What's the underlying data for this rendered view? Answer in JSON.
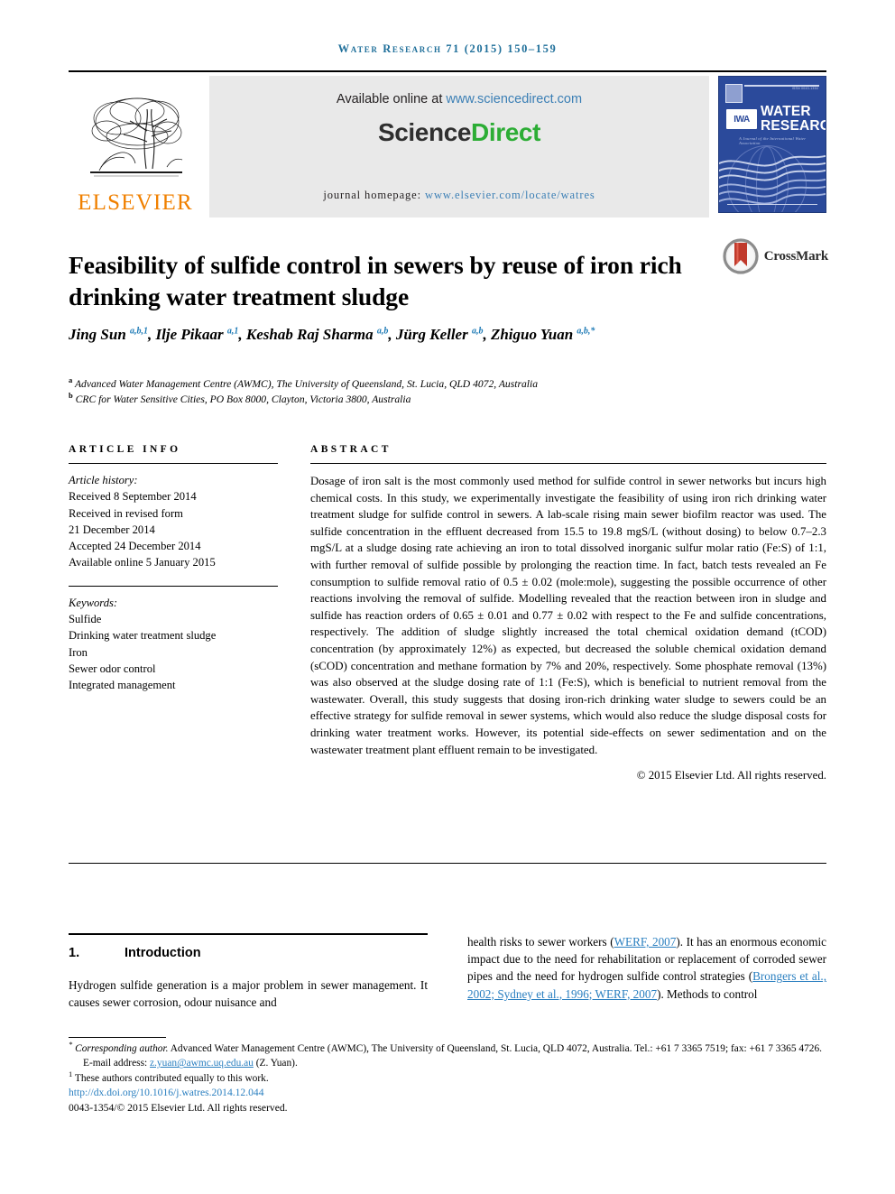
{
  "running_head": "Water Research 71 (2015) 150–159",
  "masthead": {
    "publisher_name": "ELSEVIER",
    "available_prefix": "Available online at ",
    "available_url": "www.sciencedirect.com",
    "wordmark_part1": "Science",
    "wordmark_part2": "Direct",
    "homepage_prefix": "journal homepage: ",
    "homepage_url": "www.elsevier.com/locate/watres",
    "cover": {
      "issn_text": "ISSN 0043-1354",
      "society_mark": "IWA",
      "title_line1": "WATER",
      "title_line2": "RESEARCH",
      "subtitle": "A Journal of the International Water Association"
    }
  },
  "article": {
    "title": "Feasibility of sulfide control in sewers by reuse of iron rich drinking water treatment sludge",
    "crossmark_label": "CrossMark",
    "authors_line1_prefix": "Jing Sun ",
    "authors": [
      {
        "name": "Jing Sun",
        "sup": "a,b,1"
      },
      {
        "name": "Ilje Pikaar",
        "sup": "a,1"
      },
      {
        "name": "Keshab Raj Sharma",
        "sup": "a,b"
      },
      {
        "name": "Jürg Keller",
        "sup": "a,b"
      },
      {
        "name": "Zhiguo Yuan",
        "sup": "a,b,*"
      }
    ],
    "affiliations": [
      {
        "marker": "a",
        "text": "Advanced Water Management Centre (AWMC), The University of Queensland, St. Lucia, QLD 4072, Australia"
      },
      {
        "marker": "b",
        "text": "CRC for Water Sensitive Cities, PO Box 8000, Clayton, Victoria 3800, Australia"
      }
    ]
  },
  "article_info": {
    "heading": "ARTICLE INFO",
    "history_label": "Article history:",
    "history": [
      "Received 8 September 2014",
      "Received in revised form",
      "21 December 2014",
      "Accepted 24 December 2014",
      "Available online 5 January 2015"
    ],
    "keywords_label": "Keywords:",
    "keywords": [
      "Sulfide",
      "Drinking water treatment sludge",
      "Iron",
      "Sewer odor control",
      "Integrated management"
    ]
  },
  "abstract": {
    "heading": "ABSTRACT",
    "text": "Dosage of iron salt is the most commonly used method for sulfide control in sewer networks but incurs high chemical costs. In this study, we experimentally investigate the feasibility of using iron rich drinking water treatment sludge for sulfide control in sewers. A lab-scale rising main sewer biofilm reactor was used. The sulfide concentration in the effluent decreased from 15.5 to 19.8 mgS/L (without dosing) to below 0.7–2.3 mgS/L at a sludge dosing rate achieving an iron to total dissolved inorganic sulfur molar ratio (Fe:S) of 1:1, with further removal of sulfide possible by prolonging the reaction time. In fact, batch tests revealed an Fe consumption to sulfide removal ratio of 0.5 ± 0.02 (mole:mole), suggesting the possible occurrence of other reactions involving the removal of sulfide. Modelling revealed that the reaction between iron in sludge and sulfide has reaction orders of 0.65 ± 0.01 and 0.77 ± 0.02 with respect to the Fe and sulfide concentrations, respectively. The addition of sludge slightly increased the total chemical oxidation demand (tCOD) concentration (by approximately 12%) as expected, but decreased the soluble chemical oxidation demand (sCOD) concentration and methane formation by 7% and 20%, respectively. Some phosphate removal (13%) was also observed at the sludge dosing rate of 1:1 (Fe:S), which is beneficial to nutrient removal from the wastewater. Overall, this study suggests that dosing iron-rich drinking water sludge to sewers could be an effective strategy for sulfide removal in sewer systems, which would also reduce the sludge disposal costs for drinking water treatment works. However, its potential side-effects on sewer sedimentation and on the wastewater treatment plant effluent remain to be investigated.",
    "copyright": "© 2015 Elsevier Ltd. All rights reserved."
  },
  "introduction": {
    "number": "1.",
    "heading": "Introduction",
    "left_text": "Hydrogen sulfide generation is a major problem in sewer management. It causes sewer corrosion, odour nuisance and",
    "right_text_1": "health risks to sewer workers (",
    "right_ref_1": "WERF, 2007",
    "right_text_2": "). It has an enormous economic impact due to the need for rehabilitation or replacement of corroded sewer pipes and the need for hydrogen sulfide control strategies (",
    "right_ref_2": "Brongers et al., 2002; Sydney et al., 1996; WERF, 2007",
    "right_text_3": "). Methods to control"
  },
  "footnotes": {
    "corresponding_marker": "*",
    "corresponding_label": "Corresponding author.",
    "corresponding_address": " Advanced Water Management Centre (AWMC), The University of Queensland, St. Lucia, QLD 4072, Australia. Tel.: +61 7 3365 7519; fax: +61 7 3365 4726.",
    "email_label": "E-mail address: ",
    "email": "z.yuan@awmc.uq.edu.au",
    "email_suffix": " (Z. Yuan).",
    "equal_contrib_marker": "1",
    "equal_contrib": "These authors contributed equally to this work.",
    "doi": "http://dx.doi.org/10.1016/j.watres.2014.12.044",
    "issn_copyright": "0043-1354/© 2015 Elsevier Ltd. All rights reserved."
  },
  "colors": {
    "link_blue": "#2a7fc0",
    "running_head_blue": "#1f6f9a",
    "elsevier_orange": "#f08000",
    "sciencedirect_green": "#2cad35",
    "cover_blue": "#2b4a9b"
  }
}
